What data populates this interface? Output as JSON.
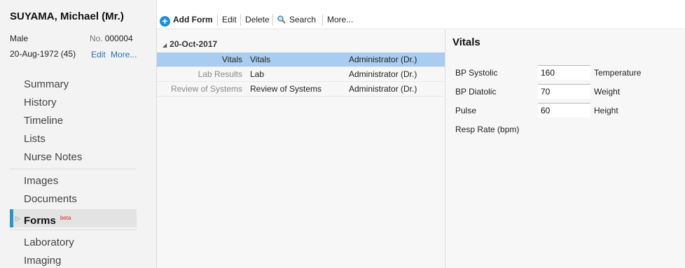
{
  "patient": {
    "name": "SUYAMA, Michael (Mr.)",
    "sex": "Male",
    "no_label": "No.",
    "no_value": "000004",
    "dob": "20-Aug-1972 (45)",
    "edit_link": "Edit",
    "more_link": "More..."
  },
  "sidebar": {
    "group1": [
      "Summary",
      "History",
      "Timeline",
      "Lists",
      "Nurse Notes"
    ],
    "group2": [
      "Images",
      "Documents"
    ],
    "active": {
      "label": "Forms",
      "badge": "beta"
    },
    "group3": [
      "Laboratory",
      "Imaging"
    ]
  },
  "toolbar": {
    "add_form": "Add Form",
    "edit": "Edit",
    "delete": "Delete",
    "search": "Search",
    "more": "More..."
  },
  "forms": {
    "date_header": "20-Oct-2017",
    "rows": [
      {
        "category": "Vitals",
        "name": "Vitals",
        "author": "Administrator (Dr.)",
        "selected": true
      },
      {
        "category": "Lab Results",
        "name": "Lab",
        "author": "Administrator (Dr.)",
        "selected": false
      },
      {
        "category": "Review of Systems",
        "name": "Review of Systems",
        "author": "Administrator (Dr.)",
        "selected": false
      }
    ]
  },
  "vitals": {
    "title": "Vitals",
    "bp_systolic_label": "BP Systolic",
    "bp_systolic_value": "160",
    "bp_diastolic_label": "BP Diatolic",
    "bp_diastolic_value": "70",
    "pulse_label": "Pulse",
    "pulse_value": "60",
    "resp_rate_label": "Resp Rate (bpm)",
    "temperature_label": "Temperature",
    "weight_label": "Weight",
    "height_label": "Height"
  },
  "colors": {
    "accent": "#2a97c9",
    "selected_row": "#a9cdf0",
    "link": "#2a6fb0",
    "beta": "#dd2222"
  },
  "icons": [
    "add-circle-icon",
    "magnifier-icon",
    "triangle-down-icon",
    "triangle-right-icon"
  ]
}
